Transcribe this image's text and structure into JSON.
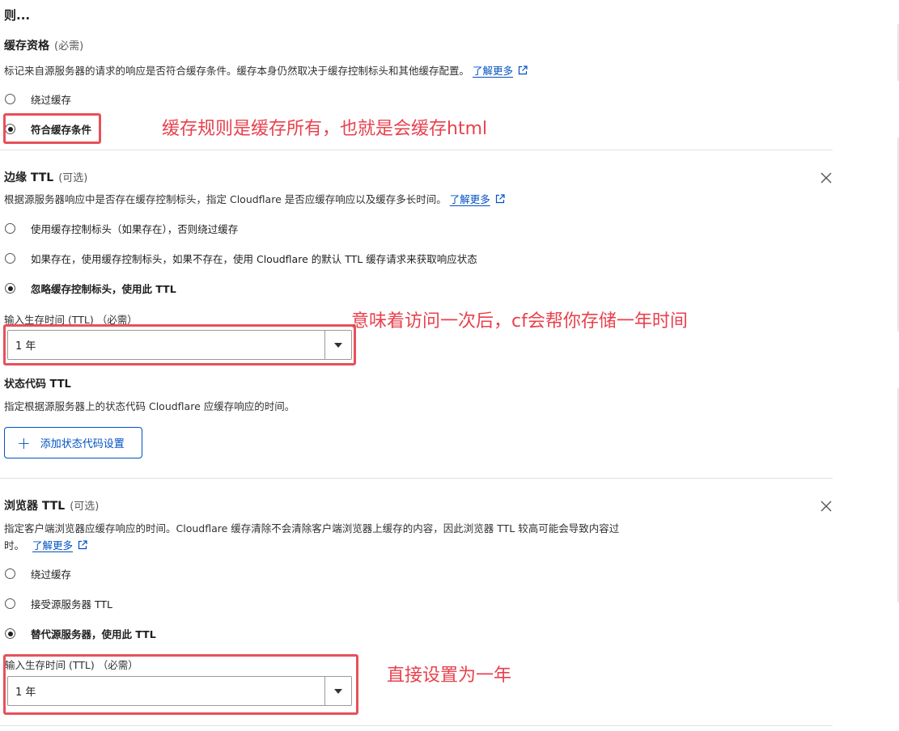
{
  "top_title": "则...",
  "cache_eligibility": {
    "title": "缓存资格",
    "optional": "(必需)",
    "description": "标记来自源服务器的请求的响应是否符合缓存条件。缓存本身仍然取决于缓存控制标头和其他缓存配置。",
    "learn_more": "了解更多",
    "options": [
      "绕过缓存",
      "符合缓存条件"
    ],
    "selected": "符合缓存条件",
    "annotation": "缓存规则是缓存所有，也就是会缓存html"
  },
  "edge_ttl": {
    "title": "边缘 TTL",
    "optional": "(可选)",
    "description": "根据源服务器响应中是否存在缓存控制标头，指定 Cloudflare 是否应缓存响应以及缓存多长时间。",
    "learn_more": "了解更多",
    "options": [
      "使用缓存控制标头（如果存在），否则绕过缓存",
      "如果存在，使用缓存控制标头，如果不存在，使用 Cloudflare 的默认 TTL 缓存请求来获取响应状态",
      "忽略缓存控制标头，使用此 TTL"
    ],
    "selected": "忽略缓存控制标头，使用此 TTL",
    "input_label": "输入生存时间 (TTL) （必需）",
    "input_value": "1 年",
    "annotation": "意味着访问一次后，cf会帮你存储一年时间",
    "status_code_title": "状态代码 TTL",
    "status_code_description": "指定根据源服务器上的状态代码 Cloudflare 应缓存响应的时间。",
    "add_button": "添加状态代码设置"
  },
  "browser_ttl": {
    "title": "浏览器 TTL",
    "optional": "(可选)",
    "description_line1": "指定客户端浏览器应缓存响应的时间。Cloudflare 缓存清除不会清除客户端浏览器上缓存的内容，因此浏览器 TTL 较高可能会导致内容过",
    "description_line2": "时。",
    "learn_more": "了解更多",
    "options": [
      "绕过缓存",
      "接受源服务器 TTL",
      "替代源服务器，使用此 TTL"
    ],
    "selected": "替代源服务器，使用此 TTL",
    "input_label": "输入生存时间 (TTL) （必需）",
    "input_value": "1 年",
    "annotation": "直接设置为一年"
  },
  "colors": {
    "link": "#0051c3",
    "annotation": "#e8414d",
    "highlight_border": "#e8505b"
  },
  "icons": {
    "external_link": "external-link-icon",
    "close": "close-icon",
    "dropdown": "chevron-down-icon",
    "add": "plus-icon"
  }
}
